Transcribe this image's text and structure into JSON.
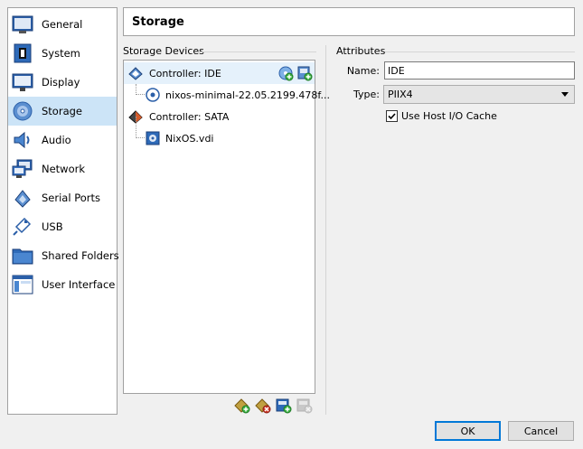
{
  "sidebar": {
    "items": [
      {
        "label": "General",
        "icon": "general-icon"
      },
      {
        "label": "System",
        "icon": "system-icon"
      },
      {
        "label": "Display",
        "icon": "display-icon"
      },
      {
        "label": "Storage",
        "icon": "storage-icon",
        "active": true
      },
      {
        "label": "Audio",
        "icon": "audio-icon"
      },
      {
        "label": "Network",
        "icon": "network-icon"
      },
      {
        "label": "Serial Ports",
        "icon": "serial-ports-icon"
      },
      {
        "label": "USB",
        "icon": "usb-icon"
      },
      {
        "label": "Shared Folders",
        "icon": "shared-folders-icon"
      },
      {
        "label": "User Interface",
        "icon": "user-interface-icon"
      }
    ]
  },
  "header": {
    "title": "Storage"
  },
  "storage_devices": {
    "title": "Storage Devices",
    "tree": [
      {
        "label": "Controller: IDE",
        "type": "controller"
      },
      {
        "label": "nixos-minimal-22.05.2199.478f...",
        "type": "optical"
      },
      {
        "label": "Controller: SATA",
        "type": "controller"
      },
      {
        "label": "NixOS.vdi",
        "type": "disk"
      }
    ]
  },
  "attributes": {
    "title": "Attributes",
    "name_label": "Name:",
    "name_value": "IDE",
    "type_label": "Type:",
    "type_value": "PIIX4",
    "host_cache_label": "Use Host I/O Cache",
    "host_cache_checked": true
  },
  "footer": {
    "ok_label": "OK",
    "cancel_label": "Cancel"
  },
  "colors": {
    "selection": "#cce4f7",
    "accent": "#0078d7"
  }
}
